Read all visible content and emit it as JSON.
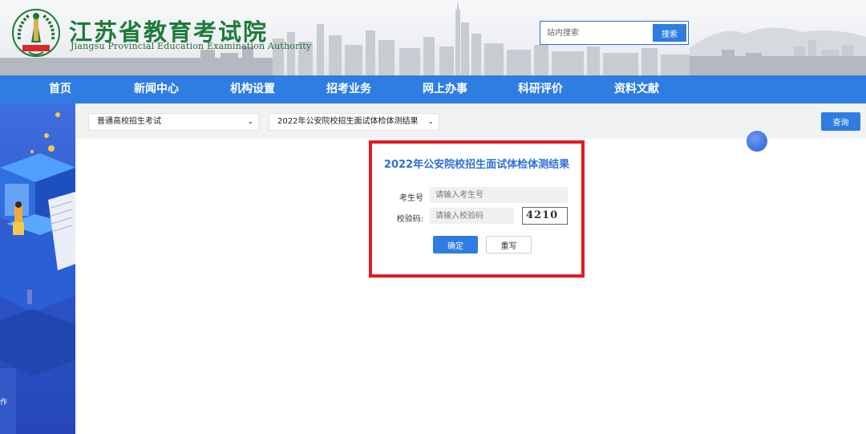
{
  "header": {
    "title_cn": "江苏省教育考试院",
    "title_en": "Jiangsu Provincial Education Examination Authority",
    "logo_icon": "jseea-emblem-icon",
    "brand_color": "#1f7a3a"
  },
  "search": {
    "placeholder": "站内搜索",
    "button_label": "搜索"
  },
  "nav": {
    "items": [
      {
        "label": "首页"
      },
      {
        "label": "新闻中心"
      },
      {
        "label": "机构设置"
      },
      {
        "label": "招考业务"
      },
      {
        "label": "网上办事"
      },
      {
        "label": "科研评价"
      },
      {
        "label": "资料文献"
      }
    ],
    "color": "#2f7de1"
  },
  "filters": {
    "exam_type": "普通高校招生考试",
    "exam_item": "2022年公安院校招生面试体检体测结果",
    "query_label": "查询"
  },
  "sidebar": {
    "text": "作"
  },
  "panel": {
    "title": "2022年公安院校招生面试体检体测结果",
    "exam_no_label": "考生号",
    "exam_no_placeholder": "请输入考生号",
    "captcha_label": "校验码:",
    "captcha_placeholder": "请输入校验码",
    "captcha_value": "4210",
    "confirm_label": "确定",
    "reset_label": "重写",
    "highlight_color": "#e11b22"
  }
}
